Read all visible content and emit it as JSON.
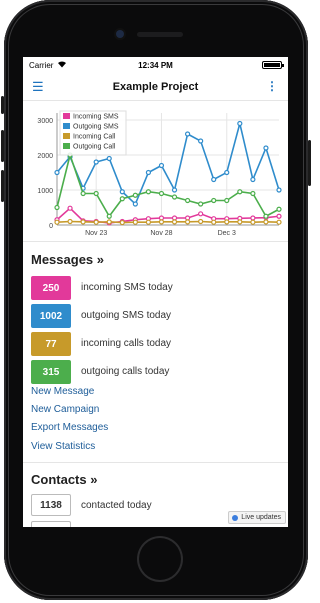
{
  "status_bar": {
    "carrier": "Carrier",
    "time": "12:34 PM",
    "battery_level": 1.0
  },
  "navbar": {
    "menu_icon": "hamburger-icon",
    "title": "Example Project",
    "more_icon": "vertical-dots-icon"
  },
  "chart_data": {
    "type": "line",
    "x": [
      "Nov 20",
      "Nov 21",
      "Nov 22",
      "Nov 23",
      "Nov 24",
      "Nov 25",
      "Nov 26",
      "Nov 27",
      "Nov 28",
      "Nov 29",
      "Nov 30",
      "Dec 1",
      "Dec 2",
      "Dec 3",
      "Dec 4",
      "Dec 5",
      "Dec 6",
      "Dec 7"
    ],
    "x_ticks": [
      "Nov 23",
      "Nov 28",
      "Dec 3"
    ],
    "y_ticks": [
      "0",
      "1000",
      "2000",
      "3000"
    ],
    "ylim": [
      0,
      3200
    ],
    "legend_position": "top-left",
    "grid": true,
    "series": [
      {
        "name": "Incoming SMS",
        "color": "#e2399a",
        "values": [
          150,
          480,
          120,
          100,
          60,
          100,
          150,
          180,
          200,
          200,
          200,
          320,
          180,
          180,
          190,
          200,
          210,
          250
        ]
      },
      {
        "name": "Outgoing SMS",
        "color": "#2f8ccc",
        "values": [
          1500,
          1950,
          1050,
          1800,
          1900,
          950,
          600,
          1500,
          1700,
          1000,
          2600,
          2400,
          1300,
          1500,
          2900,
          1300,
          2200,
          1000
        ]
      },
      {
        "name": "Incoming Call",
        "color": "#c79a2a",
        "values": [
          80,
          100,
          90,
          80,
          90,
          70,
          80,
          80,
          90,
          90,
          90,
          100,
          80,
          90,
          90,
          80,
          90,
          80
        ]
      },
      {
        "name": "Outgoing Call",
        "color": "#4cae4c",
        "values": [
          500,
          2000,
          900,
          900,
          250,
          750,
          850,
          950,
          900,
          800,
          700,
          600,
          700,
          700,
          950,
          900,
          250,
          450
        ]
      }
    ]
  },
  "messages": {
    "title": "Messages »",
    "stats": [
      {
        "value": "250",
        "label": "incoming SMS today",
        "color": "#e2399a"
      },
      {
        "value": "1002",
        "label": "outgoing SMS today",
        "color": "#2f8ccc"
      },
      {
        "value": "77",
        "label": "incoming calls today",
        "color": "#c79a2a"
      },
      {
        "value": "315",
        "label": "outgoing calls today",
        "color": "#4cae4c"
      }
    ],
    "links": [
      "New Message",
      "New Campaign",
      "Export Messages",
      "View Statistics"
    ]
  },
  "contacts": {
    "title": "Contacts »",
    "stats": [
      {
        "value": "1138",
        "label": "contacted today"
      }
    ]
  },
  "live_updates": "Live updates"
}
